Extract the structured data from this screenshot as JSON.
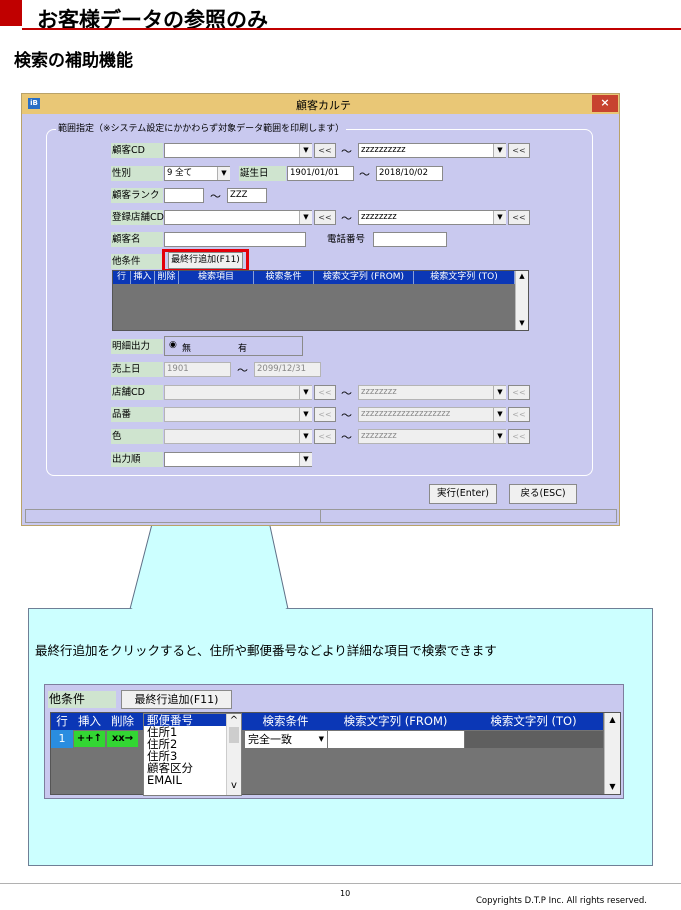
{
  "header": {
    "title": "お客様データの参照のみ",
    "subtitle": "検索の補助機能"
  },
  "window": {
    "title": "顧客カルテ",
    "app_icon": "iB",
    "close_glyph": "×",
    "group_label": "範囲指定（※システム設定にかかわらず対象データ範囲を印刷します）",
    "customer_cd": {
      "label": "顧客CD",
      "from": "",
      "to": "zzzzzzzzzz"
    },
    "gender": {
      "label": "性別",
      "value": "9 全て"
    },
    "birthday": {
      "label": "誕生日",
      "from": "1901/01/01",
      "to": "2018/10/02"
    },
    "rank": {
      "label": "顧客ランク",
      "from": "",
      "to": "ZZZ"
    },
    "store_cd": {
      "label": "登録店舗CD",
      "from": "",
      "to": "zzzzzzzz"
    },
    "customer_name": {
      "label": "顧客名",
      "value": ""
    },
    "phone": {
      "label": "電話番号",
      "value": ""
    },
    "other": {
      "label": "他条件",
      "add_button": "最終行追加(F11)"
    },
    "grid_columns": [
      "行",
      "挿入",
      "削除",
      "検索項目",
      "検索条件",
      "検索文字列 (FROM)",
      "検索文字列 (TO)"
    ],
    "detail": {
      "label": "明細出力",
      "opt_no": "無",
      "opt_yes": "有"
    },
    "sales_date": {
      "label": "売上日",
      "from": "1901",
      "to": "2099/12/31"
    },
    "store": {
      "label": "店舗CD",
      "to": "zzzzzzzz"
    },
    "item": {
      "label": "品番",
      "to": "zzzzzzzzzzzzzzzzzzzz"
    },
    "color": {
      "label": "色",
      "to": "zzzzzzzz"
    },
    "order": {
      "label": "出力順"
    },
    "shortcut_glyph": "<<",
    "tilde": "〜",
    "run_button": "実行(Enter)",
    "back_button": "戻る(ESC)"
  },
  "callout": {
    "text": "最終行追加をクリックすると、住所や郵便番号などより詳細な項目で検索できます",
    "label": "他条件",
    "add_button": "最終行追加(F11)",
    "columns": [
      "行",
      "挿入",
      "削除",
      "郵便番号",
      "検索条件",
      "検索文字列 (FROM)",
      "検索文字列 (TO)"
    ],
    "row_no": "1",
    "insert_btn": "++↑",
    "delete_btn": "xx→",
    "list_items": [
      "住所1",
      "住所2",
      "住所3",
      "顧客区分",
      "EMAIL"
    ],
    "condition": "完全一致"
  },
  "footer": {
    "page": "10",
    "copyright": "Copyrights  D.T.P Inc. All rights reserved."
  },
  "colors": {
    "accent": "#c00000",
    "window_bg": "#c9c9ef",
    "grid_header": "#0b37b6",
    "callout_bg": "#ccffff",
    "highlight": "#e3000b"
  }
}
